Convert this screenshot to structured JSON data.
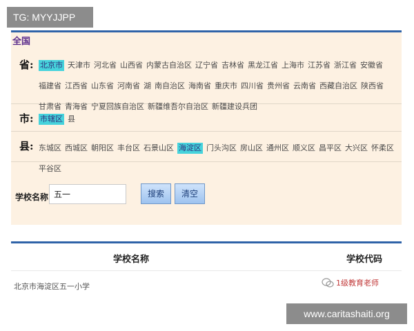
{
  "watermark_top": "TG: MYYJJPP",
  "scope": "全国",
  "filters": {
    "province": {
      "label": "省:",
      "items": [
        "北京市",
        "天津市",
        "河北省",
        "山西省",
        "内蒙古自治区",
        "辽宁省",
        "吉林省",
        "黑龙江省",
        "上海市",
        "江苏省",
        "浙江省",
        "安徽省",
        "福建省",
        "江西省",
        "山东省",
        "河南省",
        "湖",
        "南自治区",
        "海南省",
        "重庆市",
        "四川省",
        "贵州省",
        "云南省",
        "西藏自治区",
        "陕西省",
        "甘肃省",
        "青海省",
        "宁夏回族自治区",
        "新疆维吾尔自治区",
        "新疆建设兵团"
      ],
      "selected_index": 0
    },
    "city": {
      "label": "市:",
      "items": [
        "市辖区",
        "县"
      ],
      "selected_index": 0
    },
    "county": {
      "label": "县:",
      "items": [
        "东城区",
        "西城区",
        "朝阳区",
        "丰台区",
        "石景山区",
        "海淀区",
        "门头沟区",
        "房山区",
        "通州区",
        "顺义区",
        "昌平区",
        "大兴区",
        "怀柔区",
        "平谷区"
      ],
      "selected_index": 5
    }
  },
  "search": {
    "label": "学校名称:",
    "value": "五一",
    "search_button": "搜索",
    "clear_button": "清空"
  },
  "results": {
    "columns": [
      "学校名称",
      "学校代码"
    ],
    "rows": [
      {
        "name": "北京市海淀区五一小学",
        "code": ""
      }
    ]
  },
  "wechat_overlay": "1级教育老师",
  "watermark_bottom": "www.caritashaiti.org",
  "colors": {
    "panel_bg": "#fdf1e2",
    "accent_border": "#2f63a8",
    "selected_chip": "#46d3dc",
    "button_bg": "#9ec3ef"
  }
}
